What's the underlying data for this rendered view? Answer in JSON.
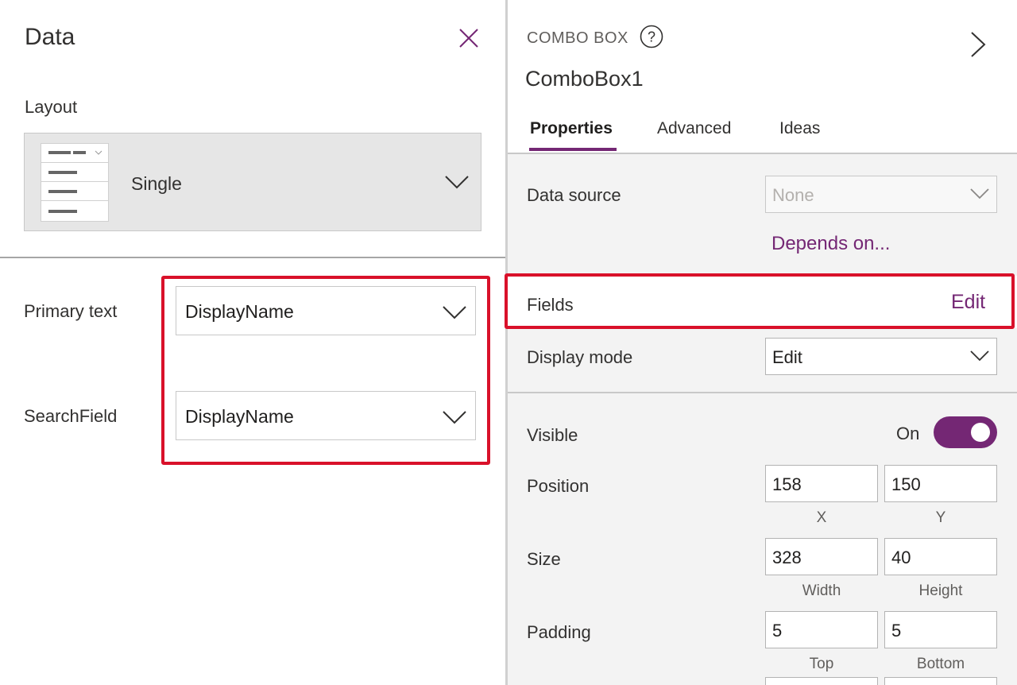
{
  "data_panel": {
    "title": "Data",
    "layout_label": "Layout",
    "layout_value": "Single",
    "primary_text_label": "Primary text",
    "primary_text_value": "DisplayName",
    "search_field_label": "SearchField",
    "search_field_value": "DisplayName"
  },
  "props": {
    "control_type": "COMBO BOX",
    "control_name": "ComboBox1",
    "tabs": [
      "Properties",
      "Advanced",
      "Ideas"
    ],
    "active_tab": "Properties",
    "data_source_label": "Data source",
    "data_source_value": "None",
    "depends_on": "Depends on...",
    "fields_label": "Fields",
    "fields_edit": "Edit",
    "display_mode_label": "Display mode",
    "display_mode_value": "Edit",
    "visible_label": "Visible",
    "visible_value": "On",
    "position_label": "Position",
    "position_x": "158",
    "position_y": "150",
    "x_label": "X",
    "y_label": "Y",
    "size_label": "Size",
    "width": "328",
    "height": "40",
    "width_label": "Width",
    "height_label": "Height",
    "padding_label": "Padding",
    "padding_top": "5",
    "padding_bottom": "5",
    "top_label": "Top",
    "bottom_label": "Bottom"
  },
  "colors": {
    "accent": "#742774",
    "highlight": "#d9112a"
  }
}
